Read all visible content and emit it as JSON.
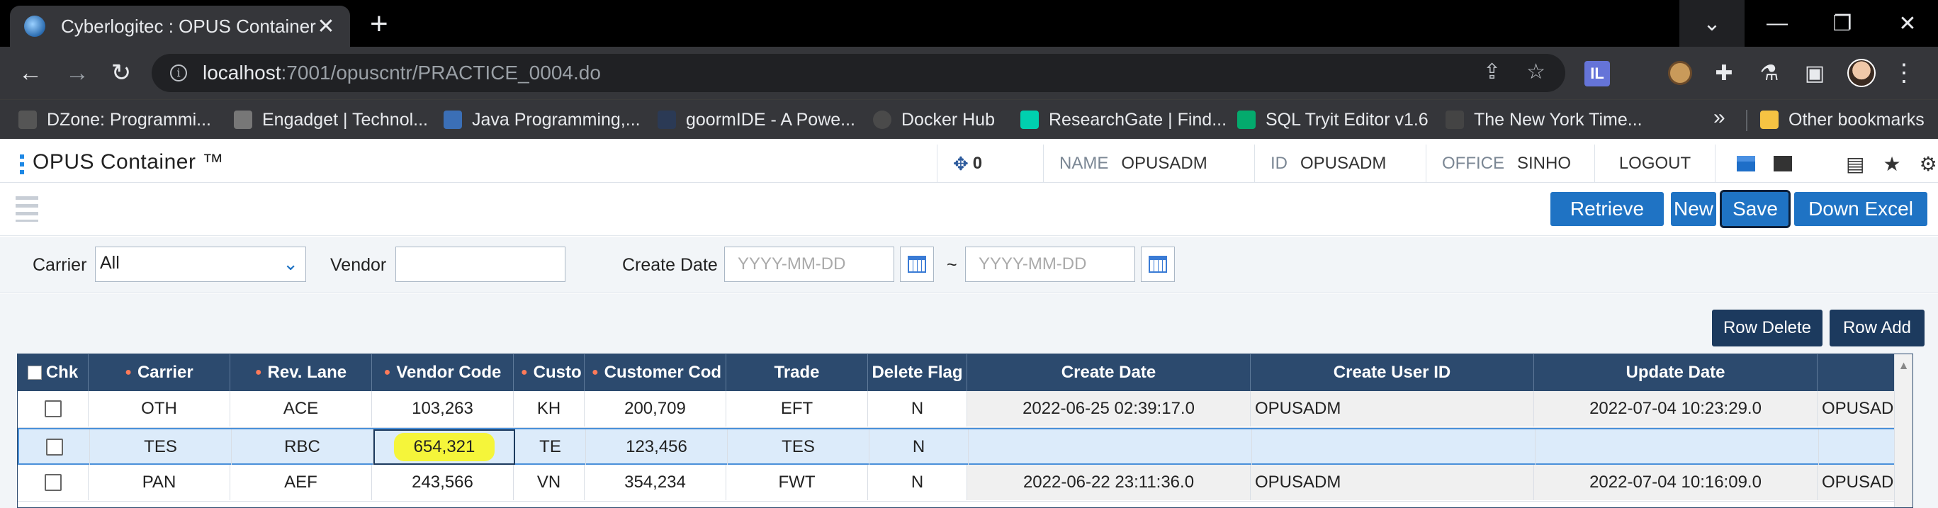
{
  "browser": {
    "tab_title": "Cyberlogitec : OPUS Container",
    "url_host": "localhost",
    "url_rest": ":7001/opuscntr/PRACTICE_0004.do",
    "bookmarks": [
      {
        "label": "DZone: Programmi...",
        "color": "#555555"
      },
      {
        "label": "Engadget | Technol...",
        "color": "#777777"
      },
      {
        "label": "Java Programming,...",
        "color": "#3b6fb6"
      },
      {
        "label": "goormIDE - A Powe...",
        "color": "#2b3a55"
      },
      {
        "label": "Docker Hub",
        "color": "#4a4a4a"
      },
      {
        "label": "ResearchGate | Find...",
        "color": "#00d0af"
      },
      {
        "label": "SQL Tryit Editor v1.6",
        "color": "#04aa6d"
      },
      {
        "label": "The New York Time...",
        "color": "#444444"
      }
    ],
    "more_bookmarks": "»",
    "other_bookmarks": "Other bookmarks"
  },
  "app": {
    "logo": "OPUS Container ™",
    "alarm_count": "0",
    "name_label": "NAME",
    "name_value": "OPUSADM",
    "id_label": "ID",
    "id_value": "OPUSADM",
    "office_label": "OFFICE",
    "office_value": "SINHO",
    "logout": "LOGOUT"
  },
  "toolbar": {
    "retrieve": "Retrieve",
    "new": "New",
    "save": "Save",
    "down_excel": "Down Excel"
  },
  "search": {
    "carrier_label": "Carrier",
    "carrier_value": "All",
    "vendor_label": "Vendor",
    "vendor_value": "",
    "create_date_label": "Create Date",
    "date_from_placeholder": "YYYY-MM-DD",
    "date_sep": "~",
    "date_to_placeholder": "YYYY-MM-DD"
  },
  "grid_buttons": {
    "row_delete": "Row Delete",
    "row_add": "Row Add"
  },
  "grid": {
    "headers": [
      "Chk",
      "Carrier",
      "Rev. Lane",
      "Vendor Code",
      "Custo",
      "Customer Cod",
      "Trade",
      "Delete Flag",
      "Create Date",
      "Create User ID",
      "Update Date",
      ""
    ],
    "rows": [
      {
        "carrier": "OTH",
        "rev_lane": "ACE",
        "vendor_code": "103,263",
        "cust": "KH",
        "customer_code": "200,709",
        "trade": "EFT",
        "delete_flag": "N",
        "create_date": "2022-06-25 02:39:17.0",
        "create_user": "OPUSADM",
        "update_date": "2022-07-04 10:23:29.0",
        "update_user": "OPUSAD"
      },
      {
        "carrier": "TES",
        "rev_lane": "RBC",
        "vendor_code": "654,321",
        "cust": "TE",
        "customer_code": "123,456",
        "trade": "TES",
        "delete_flag": "N",
        "create_date": "",
        "create_user": "",
        "update_date": "",
        "update_user": ""
      },
      {
        "carrier": "PAN",
        "rev_lane": "AEF",
        "vendor_code": "243,566",
        "cust": "VN",
        "customer_code": "354,234",
        "trade": "FWT",
        "delete_flag": "N",
        "create_date": "2022-06-22 23:11:36.0",
        "create_user": "OPUSADM",
        "update_date": "2022-07-04 10:16:09.0",
        "update_user": "OPUSAD"
      }
    ],
    "selected_row": 1,
    "highlight_color": "#f5f53a"
  }
}
